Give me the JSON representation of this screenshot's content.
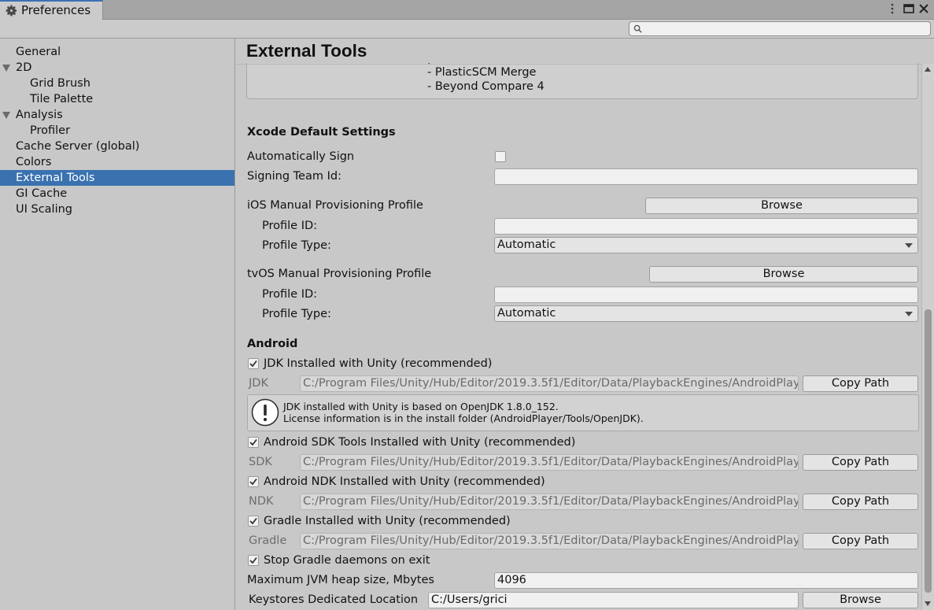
{
  "window": {
    "tab_title": "Preferences",
    "icons": [
      "gear-icon",
      "more-vertical-icon",
      "maximize-icon",
      "close-icon"
    ]
  },
  "search": {
    "value": "",
    "placeholder": ""
  },
  "sidebar": {
    "items": [
      {
        "label": "General",
        "indent": 0
      },
      {
        "label": "2D",
        "indent": 0,
        "expanded": true
      },
      {
        "label": "Grid Brush",
        "indent": 1
      },
      {
        "label": "Tile Palette",
        "indent": 1
      },
      {
        "label": "Analysis",
        "indent": 0,
        "expanded": true
      },
      {
        "label": "Profiler",
        "indent": 1
      },
      {
        "label": "Cache Server (global)",
        "indent": 0
      },
      {
        "label": "Colors",
        "indent": 0
      },
      {
        "label": "External Tools",
        "indent": 0,
        "selected": true
      },
      {
        "label": "GI Cache",
        "indent": 0
      },
      {
        "label": "UI Scaling",
        "indent": 0
      }
    ]
  },
  "main": {
    "title": "External Tools",
    "diff_tools_list": [
      "- PlasticSCM Merge",
      "- Beyond Compare 4"
    ],
    "xcode": {
      "heading": "Xcode Default Settings",
      "auto_sign_label": "Automatically Sign",
      "auto_sign_checked": false,
      "signing_team_label": "Signing Team Id:",
      "signing_team_value": "",
      "ios_profile_label": "iOS Manual Provisioning Profile",
      "ios_browse": "Browse",
      "ios_profile_id_label": "Profile ID:",
      "ios_profile_id_value": "",
      "ios_profile_type_label": "Profile Type:",
      "ios_profile_type_value": "Automatic",
      "tvos_profile_label": "tvOS Manual Provisioning Profile",
      "tvos_browse": "Browse",
      "tvos_profile_id_label": "Profile ID:",
      "tvos_profile_id_value": "",
      "tvos_profile_type_label": "Profile Type:",
      "tvos_profile_type_value": "Automatic"
    },
    "android": {
      "heading": "Android",
      "jdk_toggle_label": "JDK Installed with Unity (recommended)",
      "jdk_checked": true,
      "jdk_label": "JDK",
      "jdk_path": "C:/Program Files/Unity/Hub/Editor/2019.3.5f1/Editor/Data/PlaybackEngines/AndroidPlayer/OpenJDK",
      "jdk_copy": "Copy Path",
      "jdk_info_line1": "JDK installed with Unity is based on OpenJDK 1.8.0_152.",
      "jdk_info_line2": "License information is in the install folder (AndroidPlayer/Tools/OpenJDK).",
      "sdk_toggle_label": "Android SDK Tools Installed with Unity (recommended)",
      "sdk_checked": true,
      "sdk_label": "SDK",
      "sdk_path": "C:/Program Files/Unity/Hub/Editor/2019.3.5f1/Editor/Data/PlaybackEngines/AndroidPlayer/SDK",
      "sdk_copy": "Copy Path",
      "ndk_toggle_label": "Android NDK Installed with Unity (recommended)",
      "ndk_checked": true,
      "ndk_label": "NDK",
      "ndk_path": "C:/Program Files/Unity/Hub/Editor/2019.3.5f1/Editor/Data/PlaybackEngines/AndroidPlayer/NDK",
      "ndk_copy": "Copy Path",
      "gradle_toggle_label": "Gradle Installed with Unity (recommended)",
      "gradle_checked": true,
      "gradle_label": "Gradle",
      "gradle_path": "C:/Program Files/Unity/Hub/Editor/2019.3.5f1/Editor/Data/PlaybackEngines/AndroidPlayer/Tools/gradle",
      "gradle_copy": "Copy Path",
      "stop_gradle_label": "Stop Gradle daemons on exit",
      "stop_gradle_checked": true,
      "jvm_heap_label": "Maximum JVM heap size, Mbytes",
      "jvm_heap_value": "4096",
      "keystore_label": "Keystores Dedicated Location",
      "keystore_value": "C:/Users/grici",
      "keystore_browse": "Browse"
    }
  },
  "colors": {
    "selection": "#3a72b0",
    "panel": "#c8c8c8"
  }
}
